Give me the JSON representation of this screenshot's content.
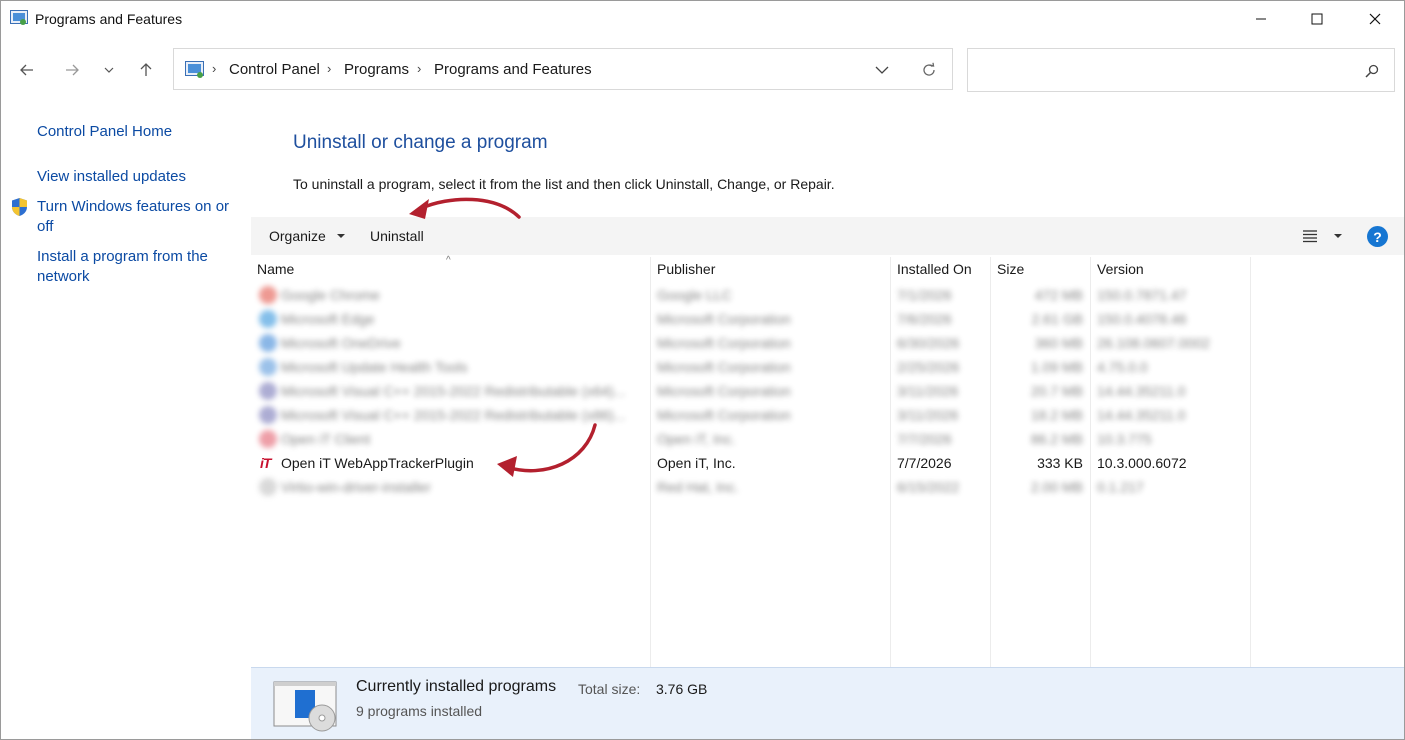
{
  "window": {
    "title": "Programs and Features"
  },
  "address_bar": {
    "breadcrumbs": [
      "Control Panel",
      "Programs",
      "Programs and Features"
    ],
    "separator": "›"
  },
  "search": {
    "placeholder": ""
  },
  "left_pane": {
    "links": [
      "Control Panel Home",
      "View installed updates",
      "Turn Windows features on or off",
      "Install a program from the network"
    ]
  },
  "main": {
    "title": "Uninstall or change a program",
    "description": "To uninstall a program, select it from the list and then click Uninstall, Change, or Repair."
  },
  "toolbar": {
    "organize_label": "Organize",
    "uninstall_label": "Uninstall",
    "help_label": "?"
  },
  "table": {
    "columns": [
      "Name",
      "Publisher",
      "Installed On",
      "Size",
      "Version"
    ],
    "rows": [
      {
        "name": "Google Chrome",
        "publisher": "Google LLC",
        "installed_on": "7/1/2026",
        "size": "472 MB",
        "version": "150.0.7871.47",
        "blurred": true,
        "icon": "chrome-icon",
        "icon_color": "#e0463a"
      },
      {
        "name": "Microsoft Edge",
        "publisher": "Microsoft Corporation",
        "installed_on": "7/6/2026",
        "size": "2.61 GB",
        "version": "150.0.4078.46",
        "blurred": true,
        "icon": "edge-icon",
        "icon_color": "#1f8ad9"
      },
      {
        "name": "Microsoft OneDrive",
        "publisher": "Microsoft Corporation",
        "installed_on": "6/30/2026",
        "size": "360 MB",
        "version": "26.108.0607.0002",
        "blurred": true,
        "icon": "onedrive-icon",
        "icon_color": "#2b7cd3"
      },
      {
        "name": "Microsoft Update Health Tools",
        "publisher": "Microsoft Corporation",
        "installed_on": "2/25/2026",
        "size": "1.09 MB",
        "version": "4.75.0.0",
        "blurred": true,
        "icon": "update-icon",
        "icon_color": "#4a8fd8"
      },
      {
        "name": "Microsoft Visual C++ 2015-2022 Redistributable (x64)...",
        "publisher": "Microsoft Corporation",
        "installed_on": "3/11/2026",
        "size": "20.7 MB",
        "version": "14.44.35211.0",
        "blurred": true,
        "icon": "vcredist-icon",
        "icon_color": "#6a6ab0"
      },
      {
        "name": "Microsoft Visual C++ 2015-2022 Redistributable (x86)...",
        "publisher": "Microsoft Corporation",
        "installed_on": "3/11/2026",
        "size": "18.2 MB",
        "version": "14.44.35211.0",
        "blurred": true,
        "icon": "vcredist-icon",
        "icon_color": "#6a6ab0"
      },
      {
        "name": "Open iT Client",
        "publisher": "Open iT, Inc.",
        "installed_on": "7/7/2026",
        "size": "86.2 MB",
        "version": "10.3.775",
        "blurred": true,
        "icon": "openit-icon",
        "icon_color": "#e05060"
      },
      {
        "name": "Open iT WebAppTrackerPlugin",
        "publisher": "Open iT, Inc.",
        "installed_on": "7/7/2026",
        "size": "333 KB",
        "version": "10.3.000.6072",
        "blurred": false,
        "icon": "openit-logo-icon",
        "icon_color": "#c8102e"
      },
      {
        "name": "Virtio-win-driver-installer",
        "publisher": "Red Hat, Inc.",
        "installed_on": "6/15/2022",
        "size": "2.00 MB",
        "version": "0.1.217",
        "blurred": true,
        "icon": "redhat-icon",
        "icon_color": "#bbbbbb"
      }
    ]
  },
  "status_bar": {
    "title": "Currently installed programs",
    "total_size_label": "Total size:",
    "total_size_value": "3.76 GB",
    "count_text": "9 programs installed"
  },
  "colors": {
    "link": "#0b4aa3",
    "heading": "#1e4f9e",
    "annotation_arrow": "#b3202e",
    "status_bg": "#e9f1fb"
  }
}
